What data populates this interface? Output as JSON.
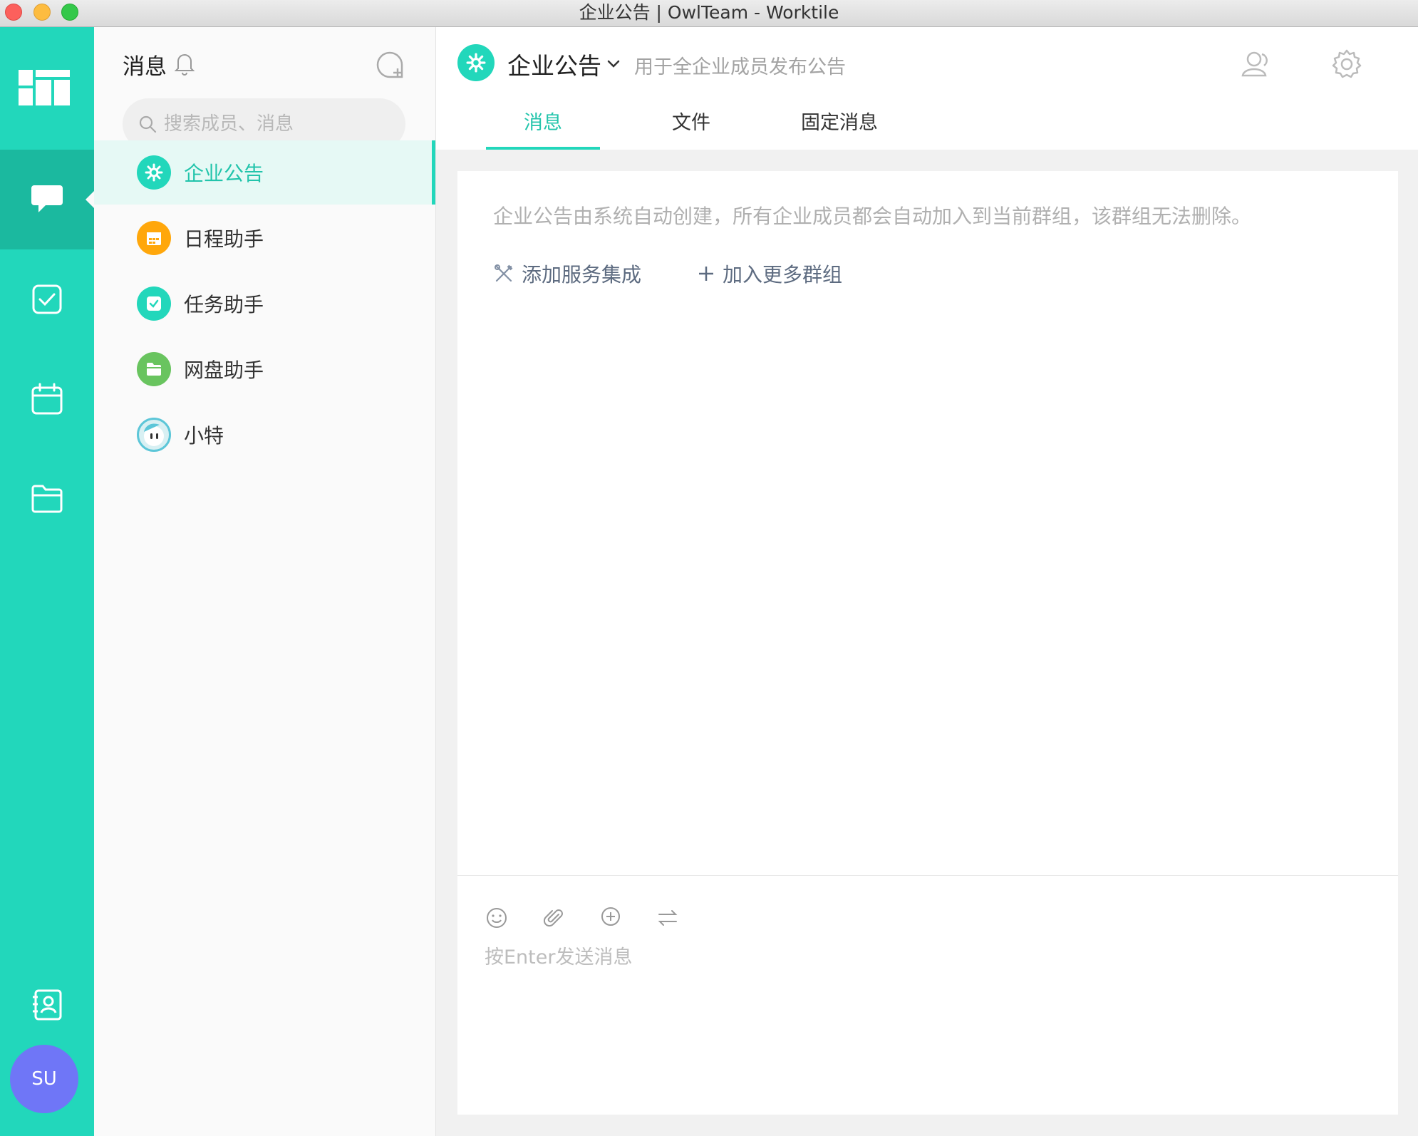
{
  "window": {
    "title": "企业公告 | OwlTeam - Worktile"
  },
  "rail": {
    "items": [
      {
        "name": "messages",
        "icon": "chat-bubble-icon"
      },
      {
        "name": "tasks",
        "icon": "checkbox-icon"
      },
      {
        "name": "calendar",
        "icon": "calendar-icon"
      },
      {
        "name": "files",
        "icon": "folder-icon"
      },
      {
        "name": "contacts",
        "icon": "contacts-icon"
      }
    ],
    "active": "messages",
    "avatar_initials": "SU"
  },
  "list": {
    "title": "消息",
    "search_placeholder": "搜索成员、消息",
    "conversations": [
      {
        "label": "企业公告",
        "color": "#22d7bb",
        "icon": "gear-icon",
        "active": true
      },
      {
        "label": "日程助手",
        "color": "#ffa70b",
        "icon": "calendar-icon",
        "active": false
      },
      {
        "label": "任务助手",
        "color": "#22d7bb",
        "icon": "checkbox-icon",
        "active": false
      },
      {
        "label": "网盘助手",
        "color": "#69c45f",
        "icon": "folder-icon",
        "active": false
      },
      {
        "label": "小特",
        "color": "#5cc6d8",
        "icon": "robot-avatar-icon",
        "active": false
      }
    ]
  },
  "channel": {
    "name": "企业公告",
    "description": "用于全企业成员发布公告",
    "tabs": [
      "消息",
      "文件",
      "固定消息"
    ],
    "active_tab": "消息",
    "notice": "企业公告由系统自动创建，所有企业成员都会自动加入到当前群组，该群组无法删除。",
    "actions": {
      "add_integration": "添加服务集成",
      "join_groups": "加入更多群组"
    }
  },
  "composer": {
    "placeholder": "按Enter发送消息",
    "tools": [
      "emoji-icon",
      "attachment-icon",
      "plus-circle-icon",
      "swap-icon"
    ]
  },
  "colors": {
    "accent": "#22d7bb",
    "avatar": "#6f76f7"
  }
}
